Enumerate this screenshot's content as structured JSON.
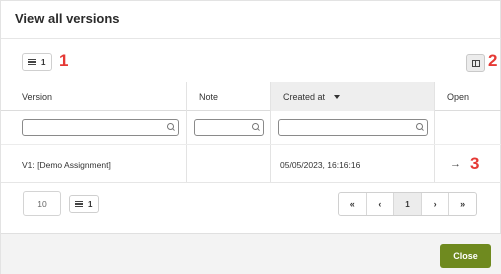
{
  "dialog": {
    "title": "View all versions"
  },
  "toolbar": {
    "row_count": "1",
    "annotation_1": "1",
    "annotation_2": "2"
  },
  "table": {
    "columns": [
      {
        "label": "Version"
      },
      {
        "label": "Note"
      },
      {
        "label": "Created at",
        "sorted": "desc"
      },
      {
        "label": "Open"
      }
    ],
    "filters": {
      "version_value": "",
      "note_value": "",
      "created_value": ""
    },
    "rows": [
      {
        "version": "V1: [Demo Assignment]",
        "note": "",
        "created_at": "05/05/2023, 16:16:16",
        "annotation": "3"
      }
    ]
  },
  "pagination": {
    "page_size": "10",
    "row_count": "1",
    "first": "«",
    "prev": "‹",
    "current_page": "1",
    "next": "›",
    "last": "»"
  },
  "footer": {
    "close_label": "Close",
    "close_color": "#6f8a1f"
  },
  "icons": {
    "list": "list-icon",
    "columns": "columns-icon",
    "search": "search-icon",
    "arrow": "arrow-right-icon"
  }
}
